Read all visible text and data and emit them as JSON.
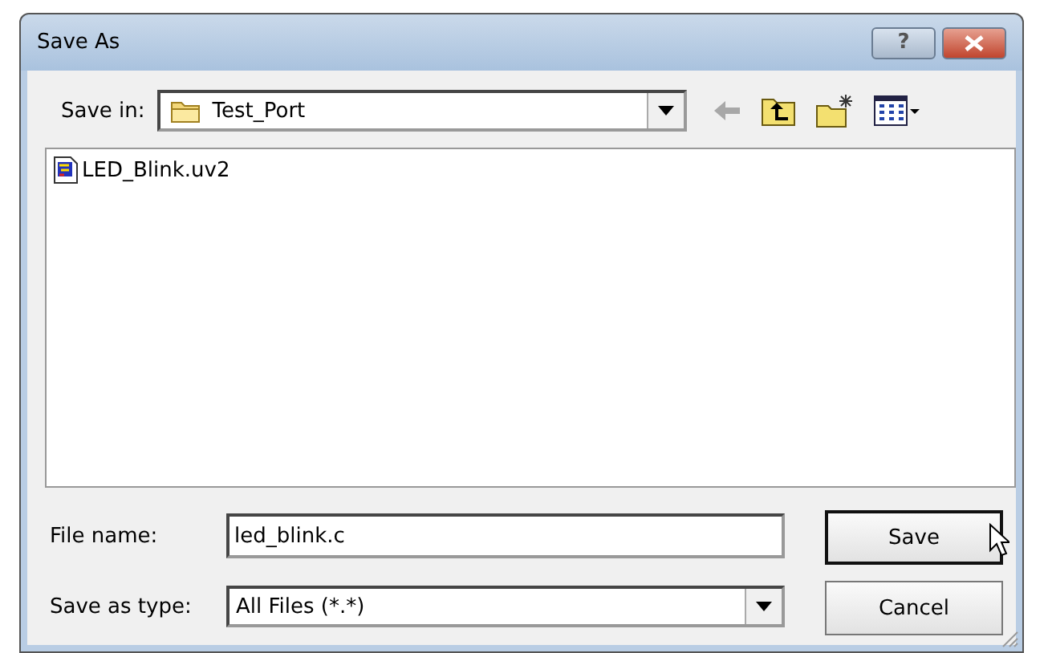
{
  "window": {
    "title": "Save As"
  },
  "title_buttons": [
    {
      "kind": "help",
      "label": "?"
    },
    {
      "kind": "close"
    }
  ],
  "save_in": {
    "label": "Save in:",
    "value": "Test_Port"
  },
  "files": [
    {
      "name": "LED_Blink.uv2"
    }
  ],
  "file_name": {
    "label": "File name:",
    "value": "led_blink.c"
  },
  "save_as_type": {
    "label": "Save as type:",
    "value": "All Files (*.*)"
  },
  "buttons": [
    {
      "label": "Save",
      "default": true
    },
    {
      "label": "Cancel",
      "default": false
    }
  ]
}
